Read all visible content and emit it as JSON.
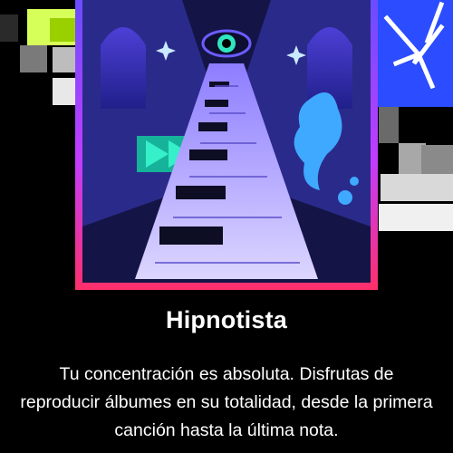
{
  "card": {
    "title": "Hipnotista",
    "description": "Tu concentración es absoluta. Disfrutas de reproducir álbumes en su totalidad, desde la primera canción hasta la última nota."
  },
  "artwork": {
    "icon": "hypnotist-piano-eye-artwork",
    "colors": {
      "frame_top": "#6a4dff",
      "frame_bottom": "#ff2f6a",
      "keys": "#c9c3ff",
      "accent": "#2ee6c0",
      "liquid": "#3fa9ff"
    }
  }
}
